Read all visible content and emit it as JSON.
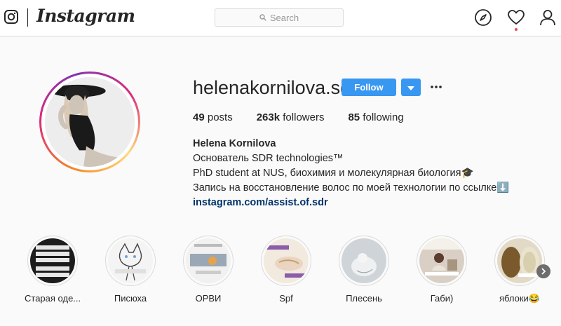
{
  "nav": {
    "wordmark": "Instagram",
    "search_placeholder": "Search"
  },
  "profile": {
    "username": "helenakornilova.sdr",
    "follow_label": "Follow",
    "stats": {
      "posts_count": "49",
      "posts_label": "posts",
      "followers_count": "263k",
      "followers_label": "followers",
      "following_count": "85",
      "following_label": "following"
    },
    "bio": {
      "name": "Helena Kornilova",
      "line1": "Основатель SDR technologies™",
      "line2": "PhD student at NUS, биохимия и молекулярная биология🎓",
      "line3": "Запись на восстановление волос по моей технологии по ссылке⬇️",
      "link": "instagram.com/assist.of.sdr"
    }
  },
  "highlights": [
    {
      "label": "Старая оде..."
    },
    {
      "label": "Писюха"
    },
    {
      "label": "ОРВИ"
    },
    {
      "label": "Spf"
    },
    {
      "label": "Плесень"
    },
    {
      "label": "Габи)"
    },
    {
      "label": "яблоки😂"
    }
  ],
  "colors": {
    "accent": "#3897f0",
    "link": "#003569",
    "notification": "#ed4956"
  }
}
